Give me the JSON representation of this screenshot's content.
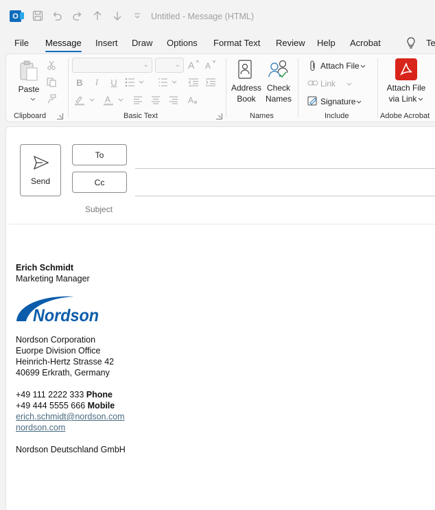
{
  "window": {
    "title": "Untitled  -  Message (HTML)",
    "app_icon_letter": "O"
  },
  "menu": {
    "tabs": [
      "File",
      "Message",
      "Insert",
      "Draw",
      "Options",
      "Format Text",
      "Review",
      "Help",
      "Acrobat"
    ],
    "active": "Message",
    "tell_me": "Te"
  },
  "ribbon": {
    "clipboard": {
      "paste": "Paste",
      "group": "Clipboard"
    },
    "basic_text": {
      "group": "Basic Text"
    },
    "names": {
      "address_book_1": "Address",
      "address_book_2": "Book",
      "check_names_1": "Check",
      "check_names_2": "Names",
      "group": "Names"
    },
    "include": {
      "attach_file": "Attach File",
      "link": "Link",
      "signature": "Signature",
      "group": "Include"
    },
    "adobe": {
      "attach_via_link_1": "Attach File",
      "attach_via_link_2": "via Link",
      "group": "Adobe Acrobat"
    }
  },
  "compose": {
    "send": "Send",
    "to": "To",
    "cc": "Cc",
    "subject": "Subject"
  },
  "signature": {
    "name": "Erich Schmidt",
    "title": "Marketing Manager",
    "logo_text": "Nordson",
    "company": "Nordson Corporation",
    "office": "Euorpe Division Office",
    "street": "Heinrich-Hertz Strasse 42",
    "city": "40699 Erkrath, Germany",
    "phone_number": "+49 111 2222 333",
    "phone_label": "Phone",
    "mobile_number": "+49 444 5555 666",
    "mobile_label": "Mobile",
    "email": "erich.schmidt@nordson.com",
    "website": "nordson.com",
    "footer_company": "Nordson Deutschland GmbH"
  },
  "colors": {
    "accent": "#0f6cbd",
    "nordson_blue": "#0b5cab",
    "adobe_red": "#d9241b",
    "link": "#4a6b80"
  }
}
